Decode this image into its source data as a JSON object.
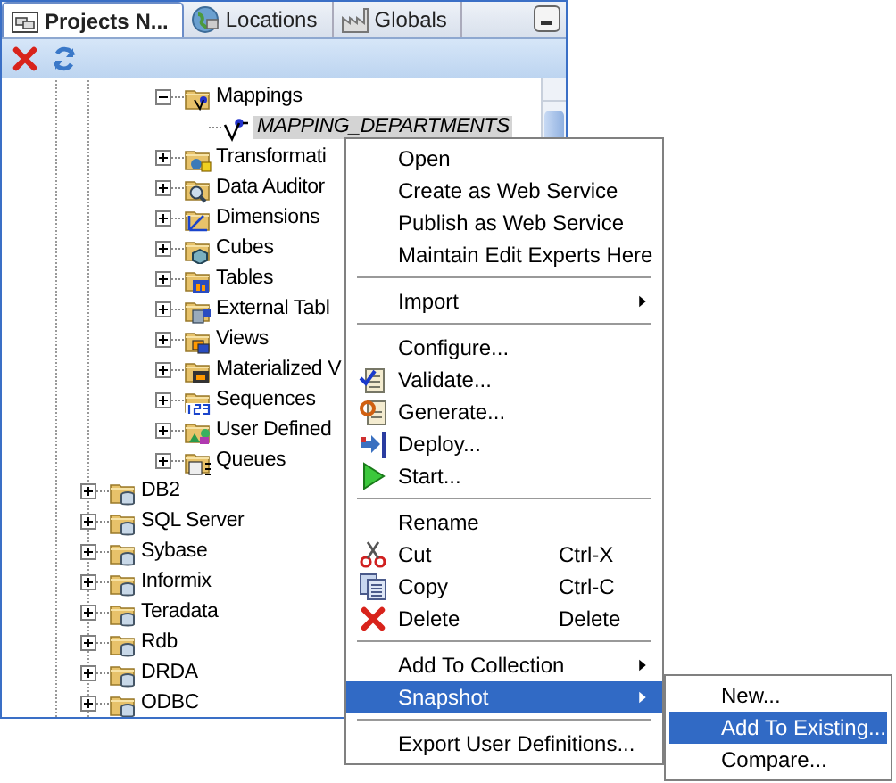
{
  "tabs": [
    {
      "label": "Projects N...",
      "selected": true
    },
    {
      "label": "Locations",
      "selected": false
    },
    {
      "label": "Globals",
      "selected": false
    }
  ],
  "tree": {
    "nodes": [
      {
        "children": [
          {
            "children": [
              {
                "label": "Mappings",
                "expanded": true,
                "children": [
                  {
                    "label": "MAPPING_DEPARTMENTS",
                    "selected": true
                  }
                ]
              },
              {
                "label": "Transformati",
                "expanded": false
              },
              {
                "label": "Data Auditor",
                "expanded": false
              },
              {
                "label": "Dimensions",
                "expanded": false
              },
              {
                "label": "Cubes",
                "expanded": false
              },
              {
                "label": "Tables",
                "expanded": false
              },
              {
                "label": "External Tabl",
                "expanded": false
              },
              {
                "label": "Views",
                "expanded": false
              },
              {
                "label": "Materialized V",
                "expanded": false
              },
              {
                "label": "Sequences",
                "expanded": false
              },
              {
                "label": "User Defined",
                "expanded": false
              },
              {
                "label": "Queues",
                "expanded": false
              }
            ]
          }
        ]
      },
      {
        "label": "DB2",
        "expanded": false
      },
      {
        "label": "SQL Server",
        "expanded": false
      },
      {
        "label": "Sybase",
        "expanded": false
      },
      {
        "label": "Informix",
        "expanded": false
      },
      {
        "label": "Teradata",
        "expanded": false
      },
      {
        "label": "Rdb",
        "expanded": false
      },
      {
        "label": "DRDA",
        "expanded": false
      },
      {
        "label": "ODBC",
        "expanded": false
      }
    ]
  },
  "context_menu": {
    "items": [
      {
        "kind": "item",
        "label": "Open",
        "selected": false
      },
      {
        "kind": "item",
        "label": "Create as Web Service",
        "selected": false
      },
      {
        "kind": "item",
        "label": "Publish as Web Service",
        "selected": false
      },
      {
        "kind": "item",
        "label": "Maintain Edit Experts Here",
        "selected": false
      },
      {
        "kind": "separator"
      },
      {
        "kind": "item",
        "label": "Import",
        "submenu": true,
        "selected": false
      },
      {
        "kind": "separator"
      },
      {
        "kind": "item",
        "label": "Configure...",
        "selected": false
      },
      {
        "kind": "item",
        "label": "Validate...",
        "selected": false
      },
      {
        "kind": "item",
        "label": "Generate...",
        "selected": false
      },
      {
        "kind": "item",
        "label": "Deploy...",
        "selected": false
      },
      {
        "kind": "item",
        "label": "Start...",
        "selected": false
      },
      {
        "kind": "separator"
      },
      {
        "kind": "item",
        "label": "Rename",
        "selected": false
      },
      {
        "kind": "item",
        "label": "Cut",
        "shortcut": "Ctrl-X",
        "selected": false
      },
      {
        "kind": "item",
        "label": "Copy",
        "shortcut": "Ctrl-C",
        "selected": false
      },
      {
        "kind": "item",
        "label": "Delete",
        "shortcut": "Delete",
        "selected": false
      },
      {
        "kind": "separator"
      },
      {
        "kind": "item",
        "label": "Add To Collection",
        "submenu": true,
        "selected": false
      },
      {
        "kind": "item",
        "label": "Snapshot",
        "submenu": true,
        "selected": true
      },
      {
        "kind": "separator"
      },
      {
        "kind": "item",
        "label": "Export User Definitions...",
        "selected": false
      }
    ]
  },
  "submenu": {
    "items": [
      {
        "label": "New...",
        "selected": false
      },
      {
        "label": "Add To Existing...",
        "selected": true
      },
      {
        "label": "Compare...",
        "selected": false
      }
    ]
  }
}
